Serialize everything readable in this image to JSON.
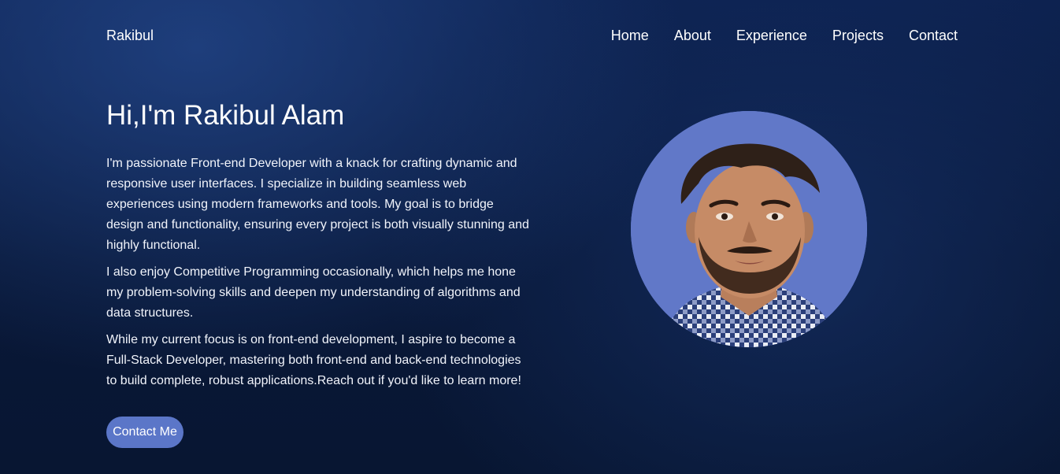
{
  "nav": {
    "brand": "Rakibul",
    "links": [
      "Home",
      "About",
      "Experience",
      "Projects",
      "Contact"
    ]
  },
  "hero": {
    "title": "Hi,I'm Rakibul Alam",
    "paragraphs": [
      "I'm passionate Front-end Developer with a knack for crafting dynamic and responsive user interfaces. I specialize in building seamless web experiences using modern frameworks and tools. My goal is to bridge design and functionality, ensuring every project is both visually stunning and highly functional.",
      "I also enjoy Competitive Programming occasionally, which helps me hone my problem-solving skills and deepen my understanding of algorithms and data structures.",
      "While my current focus is on front-end development, I aspire to become a Full-Stack Developer, mastering both front-end and back-end technologies to build complete, robust applications.Reach out if you'd like to learn more!"
    ],
    "cta_label": "Contact Me"
  },
  "colors": {
    "background": "#0a1a3d",
    "accent": "#5b76c8",
    "avatar_bg": "#6178c8"
  }
}
